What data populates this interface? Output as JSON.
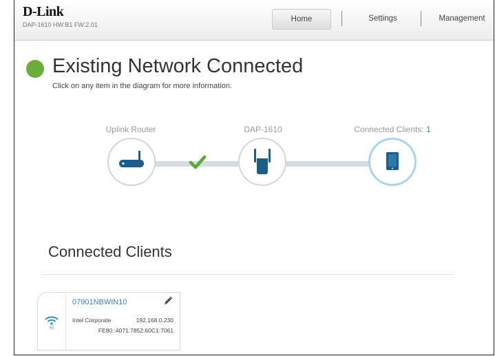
{
  "header": {
    "logo": "D-Link",
    "model_info": "DAP-1610 HW:B1 FW:2.01",
    "nav": {
      "home": "Home",
      "settings": "Settings",
      "management": "Management"
    }
  },
  "status": {
    "title": "Existing Network Connected",
    "subtitle": "Click on any item in the diagram for more information.",
    "color": "#6aad3b"
  },
  "diagram": {
    "uplink_label": "Uplink Router",
    "device_label": "DAP-1610",
    "clients_label": "Connected Clients:",
    "clients_count": "1",
    "accent": "#3b8fc7"
  },
  "clients_section": {
    "title": "Connected Clients",
    "clients": [
      {
        "name": "07901NBWIN10",
        "vendor": "Intel Corporate",
        "ip": "192.168.0.230",
        "ipv6": "FE80::4071:7852:60C1:7061",
        "band_icon": "wifi-5g-icon"
      }
    ]
  }
}
